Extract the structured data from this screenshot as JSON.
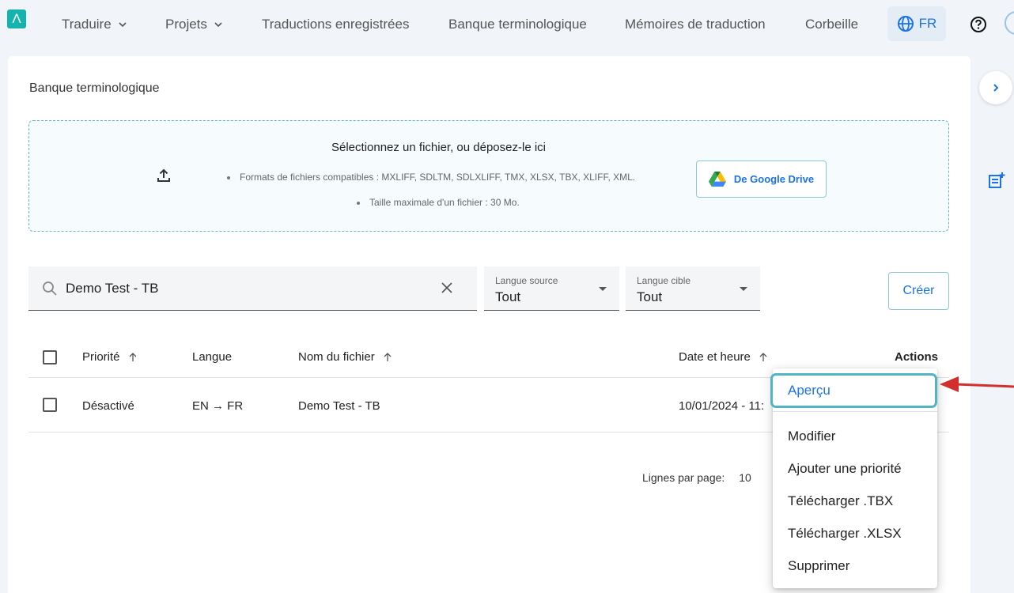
{
  "nav": {
    "logo": "Λ",
    "items": [
      {
        "label": "Traduire",
        "dropdown": true
      },
      {
        "label": "Projets",
        "dropdown": true
      },
      {
        "label": "Traductions enregistrées",
        "dropdown": false
      },
      {
        "label": "Banque terminologique",
        "dropdown": false
      },
      {
        "label": "Mémoires de traduction",
        "dropdown": false
      },
      {
        "label": "Corbeille",
        "dropdown": false
      }
    ],
    "language": "FR"
  },
  "page": {
    "title": "Banque terminologique"
  },
  "upload": {
    "title": "Sélectionnez un fichier, ou déposez-le ici",
    "formats": "Formats de fichiers compatibles : MXLIFF, SDLTM, SDLXLIFF, TMX, XLSX, TBX, XLIFF, XML.",
    "max_size": "Taille maximale d'un fichier : 30 Mo.",
    "gdrive_label": "De Google Drive"
  },
  "filters": {
    "search_value": "Demo Test - TB",
    "source_lang": {
      "label": "Langue source",
      "value": "Tout"
    },
    "target_lang": {
      "label": "Langue cible",
      "value": "Tout"
    },
    "create_label": "Créer"
  },
  "table": {
    "headers": {
      "priority": "Priorité",
      "language": "Langue",
      "filename": "Nom du fichier",
      "datetime": "Date et heure",
      "actions": "Actions"
    },
    "rows": [
      {
        "priority": "Désactivé",
        "language": "EN → FR",
        "filename": "Demo Test - TB",
        "datetime": "10/01/2024 - 11:"
      }
    ]
  },
  "pagination": {
    "rows_label": "Lignes par page:",
    "rows_value": "10"
  },
  "actions_menu": {
    "items": [
      "Aperçu",
      "Modifier",
      "Ajouter une priorité",
      "Télécharger .TBX",
      "Télécharger .XLSX",
      "Supprimer"
    ],
    "highlighted": "Aperçu"
  },
  "colors": {
    "accent": "#1a73e8",
    "logo": "#14b3ad",
    "highlight_border": "#52b3c5",
    "annotation_arrow": "#d32f2f"
  }
}
